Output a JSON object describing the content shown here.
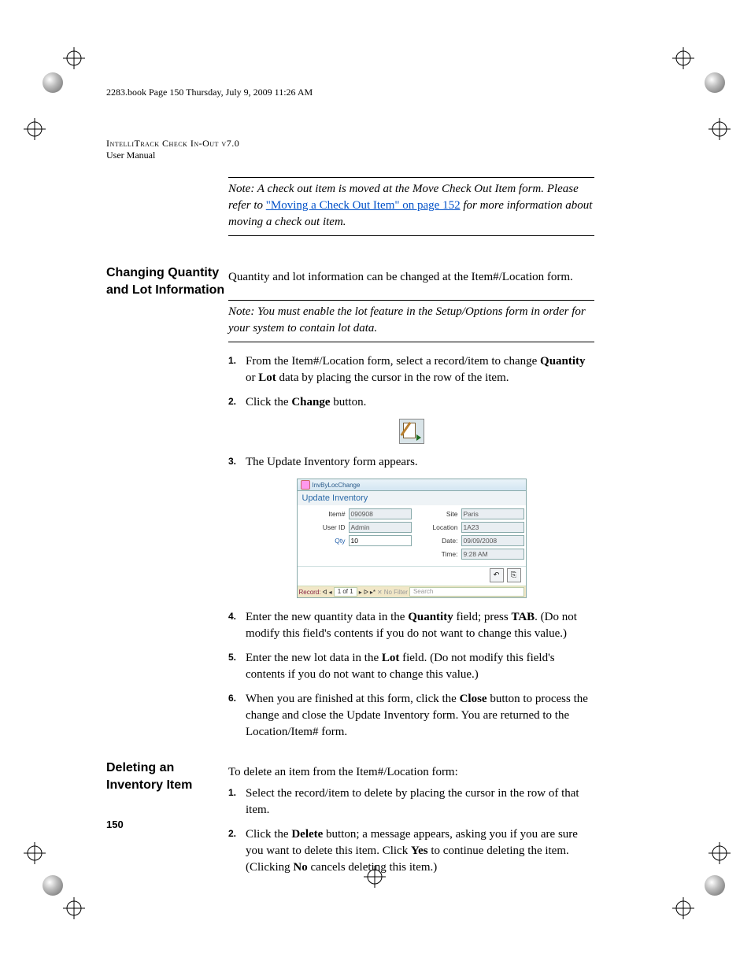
{
  "book_header": "2283.book  Page 150  Thursday, July 9, 2009  11:26 AM",
  "product_line": "IntelliTrack Check In-Out v7.0",
  "manual_line": "User Manual",
  "page_number": "150",
  "top_note": {
    "prefix": "Note:   A check out item is moved at the Move Check Out Item form. Please refer to ",
    "link": "\"Moving a Check Out Item\" on page 152",
    "suffix": " for more information about moving a check out item."
  },
  "section1": {
    "heading": "Changing Quantity and Lot Information",
    "intro": "Quantity and lot information can be changed at the Item#/Location form.",
    "note": "Note:   You must enable the lot feature in the Setup/Options form in order for your system to contain lot data.",
    "steps": [
      {
        "n": "1.",
        "t_pre": "From the Item#/Location form, select a record/item to change ",
        "b1": "Quantity",
        "mid": " or ",
        "b2": "Lot",
        "t_post": " data by placing the cursor in the row of the item."
      },
      {
        "n": "2.",
        "t_pre": "Click the ",
        "b1": "Change",
        "t_post": " button."
      },
      {
        "n": "3.",
        "plain": "The Update Inventory form appears."
      },
      {
        "n": "4.",
        "t_pre": "Enter the new quantity data in the ",
        "b1": "Quantity",
        "mid": " field; press ",
        "b2": "TAB",
        "t_post": ". (Do not modify this field's contents if you do not want to change this value.)"
      },
      {
        "n": "5.",
        "t_pre": "Enter the new lot data in the ",
        "b1": "Lot",
        "t_post": " field. (Do not modify this field's contents if you do not want to change this value.)"
      },
      {
        "n": "6.",
        "t_pre": "When you are finished at this form, click the ",
        "b1": "Close",
        "t_post": " button to process the change and close the Update Inventory form. You are returned to the Location/Item# form."
      }
    ]
  },
  "form": {
    "titlebar": "InvByLocChange",
    "subtitle": "Update Inventory",
    "item_label": "Item#",
    "item_value": "090908",
    "site_label": "Site",
    "site_value": "Paris",
    "userid_label": "User ID",
    "userid_value": "Admin",
    "location_label": "Location",
    "location_value": "1A23",
    "qty_label": "Qty",
    "qty_value": "10",
    "date_label": "Date:",
    "date_value": "09/09/2008",
    "time_label": "Time:",
    "time_value": "9:28 AM",
    "nav_record": "Record:",
    "nav_pos": "1 of 1",
    "nav_filter": "No Filter",
    "nav_search": "Search"
  },
  "section2": {
    "heading": "Deleting an Inventory Item",
    "intro": "To delete an item from the Item#/Location form:",
    "steps": [
      {
        "n": "1.",
        "plain": "Select the record/item to delete by placing the cursor in the row of that item."
      },
      {
        "n": "2.",
        "t_pre": "Click the ",
        "b1": "Delete",
        "mid": " button; a message appears, asking you if you are sure you want to delete this item. Click ",
        "b2": "Yes",
        "mid2": " to continue deleting the item. (Clicking ",
        "b3": "No",
        "t_post": " cancels deleting this item.)"
      }
    ]
  }
}
